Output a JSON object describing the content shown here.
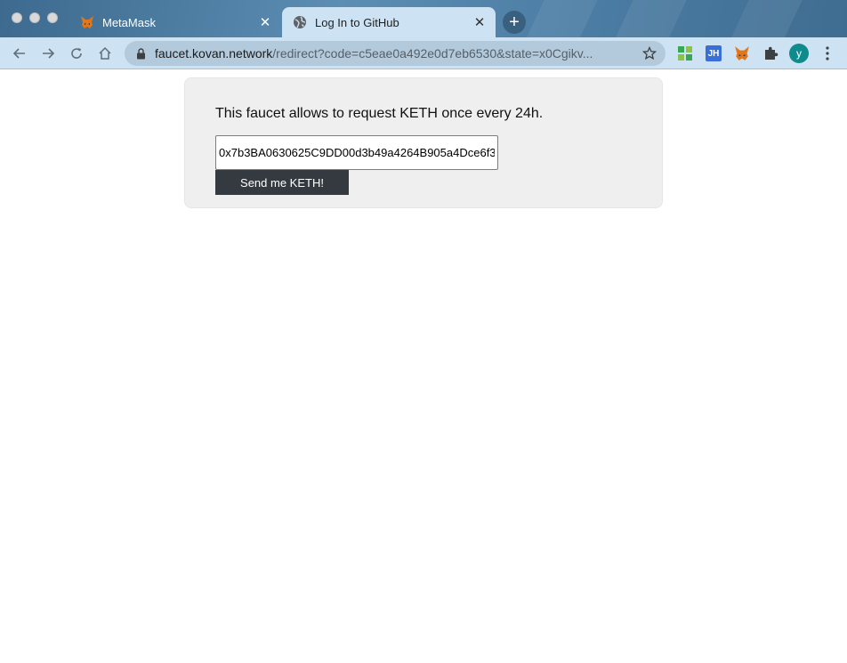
{
  "browser": {
    "tabs": [
      {
        "title": "MetaMask",
        "favicon": "metamask-fox-icon",
        "active": false
      },
      {
        "title": "Log In to GitHub",
        "favicon": "globe-icon",
        "active": true
      }
    ],
    "address_bar": {
      "host": "faucet.kovan.network",
      "path": "/redirect?code=c5eae0a492e0d7eb6530&state=x0Cgikv..."
    },
    "extensions": [
      "grid-extension-icon",
      "jh-extension-icon",
      "metamask-fox-icon",
      "puzzle-icon"
    ],
    "jh_label": "JH",
    "profile_initial": "y",
    "colors": {
      "toolbar": "#cde2f2",
      "titlebar": "#4b7ca3",
      "avatar": "#0f8b8d"
    }
  },
  "page": {
    "description": "This faucet allows to request KETH once every 24h.",
    "address_input_value": "0x7b3BA0630625C9DD00d3b49a4264B905a4Dce6f3",
    "submit_label": "Send me KETH!",
    "colors": {
      "card": "#efefef",
      "button": "#343a40"
    }
  }
}
